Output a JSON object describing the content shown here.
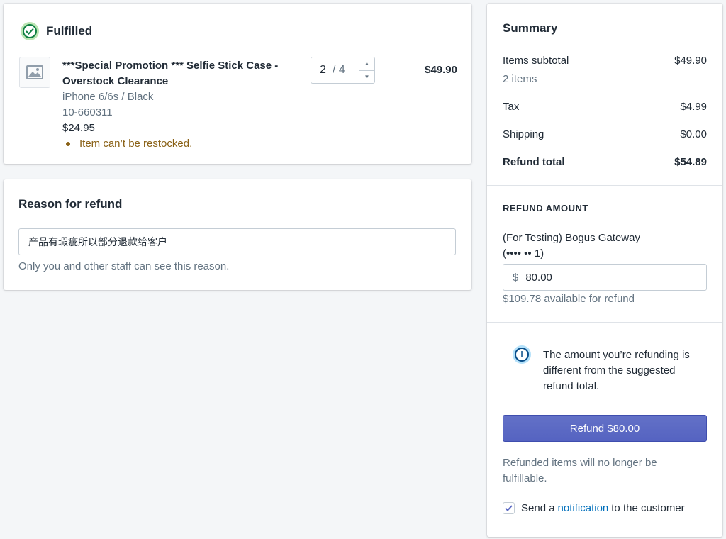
{
  "fulfilled": {
    "status": "Fulfilled",
    "item": {
      "title": "***Special Promotion *** Selfie Stick Case - Overstock Clearance",
      "variant": "iPhone 6/6s / Black",
      "sku": "10-660311",
      "price": "$24.95",
      "note": "Item can’t be restocked.",
      "quantity": "2",
      "quantity_total": "/ 4",
      "line_total": "$49.90"
    }
  },
  "reason": {
    "title": "Reason for refund",
    "value": "产品有瑕疵所以部分退款给客户",
    "help": "Only you and other staff can see this reason."
  },
  "summary": {
    "title": "Summary",
    "items_subtotal_label": "Items subtotal",
    "items_subtotal_value": "$49.90",
    "items_count": "2 items",
    "tax_label": "Tax",
    "tax_value": "$4.99",
    "shipping_label": "Shipping",
    "shipping_value": "$0.00",
    "refund_total_label": "Refund total",
    "refund_total_value": "$54.89",
    "refund_amount_label": "REFUND AMOUNT",
    "gateway_name": "(For Testing) Bogus Gateway",
    "gateway_card": "(•••• •• 1)",
    "currency_symbol": "$",
    "amount_value": "80.00",
    "available": "$109.78 available for refund",
    "info_text": "The amount you’re refunding is different from the suggested refund total.",
    "refund_button": "Refund $80.00",
    "refund_note": "Refunded items will no longer be fulfillable.",
    "notify_prefix": "Send a",
    "notify_link": "notification",
    "notify_suffix": "to the customer"
  }
}
